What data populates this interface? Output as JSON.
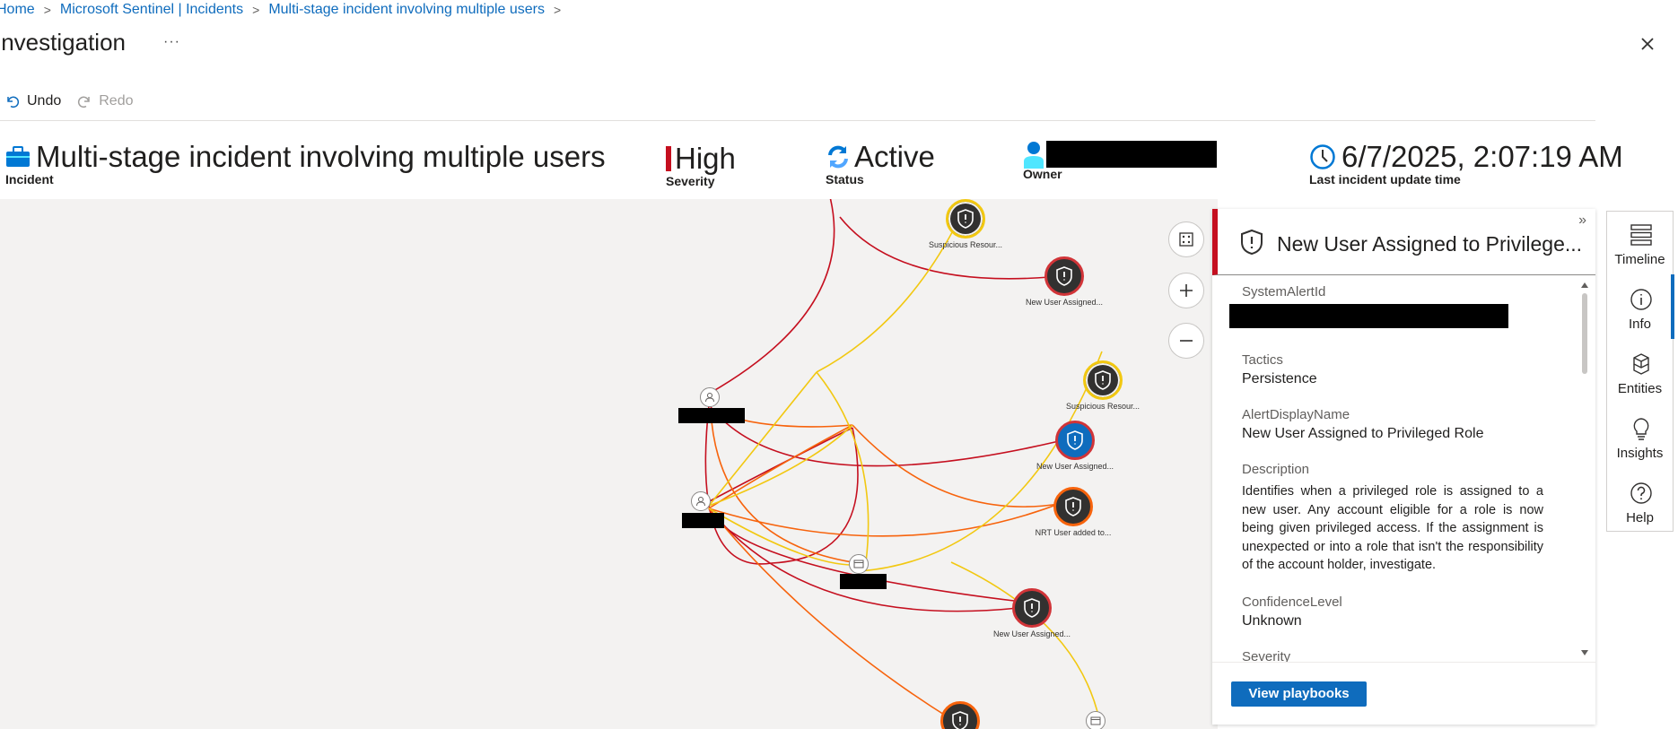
{
  "breadcrumb": {
    "items": [
      "Home",
      "Microsoft Sentinel | Incidents",
      "Multi-stage incident involving multiple users"
    ]
  },
  "page": {
    "title": "Investigation",
    "more_label": "···"
  },
  "toolbar": {
    "undo_label": "Undo",
    "redo_label": "Redo"
  },
  "incident": {
    "name": "Multi-stage incident involving multiple users",
    "name_label": "Incident",
    "severity": "High",
    "severity_label": "Severity",
    "severity_color": "#c50f1f",
    "status": "Active",
    "status_label": "Status",
    "owner_label": "Owner",
    "last_update": "6/7/2025, 2:07:19 AM",
    "last_update_label": "Last incident update time"
  },
  "graph": {
    "alert_nodes": [
      {
        "label": "Suspicious Resour...",
        "ring": "yellow"
      },
      {
        "label": "New User Assigned...",
        "ring": "red"
      },
      {
        "label": "Suspicious Resour...",
        "ring": "yellow"
      },
      {
        "label": "New User Assigned...",
        "ring": "red",
        "selected": true
      },
      {
        "label": "NRT User added to...",
        "ring": "orange"
      },
      {
        "label": "New User Assigned...",
        "ring": "red"
      },
      {
        "label": "",
        "ring": "orange"
      }
    ],
    "edge_colors": {
      "red": "#c50f1f",
      "orange": "#f7630c",
      "yellow": "#f2c811"
    }
  },
  "panel": {
    "title": "New User Assigned to Privilege...",
    "fields": {
      "system_alert_id_label": "SystemAlertId",
      "tactics_label": "Tactics",
      "tactics_value": "Persistence",
      "alert_display_name_label": "AlertDisplayName",
      "alert_display_name_value": "New User Assigned to Privileged Role",
      "description_label": "Description",
      "description_value": "Identifies when a privileged role is assigned to a new user. Any account eligible for a role is now being given privileged access. If the assignment is unexpected or into a role that isn't the responsibility of the account holder, investigate.",
      "confidence_label": "ConfidenceLevel",
      "confidence_value": "Unknown",
      "severity_label": "Severity"
    },
    "view_playbooks_label": "View playbooks",
    "collapse_icon": "double-chevron-right-icon"
  },
  "rail": {
    "items": [
      {
        "label": "Timeline",
        "icon": "timeline-icon"
      },
      {
        "label": "Info",
        "icon": "info-icon",
        "selected": true
      },
      {
        "label": "Entities",
        "icon": "entities-icon"
      },
      {
        "label": "Insights",
        "icon": "lightbulb-icon"
      },
      {
        "label": "Help",
        "icon": "help-icon"
      }
    ]
  }
}
